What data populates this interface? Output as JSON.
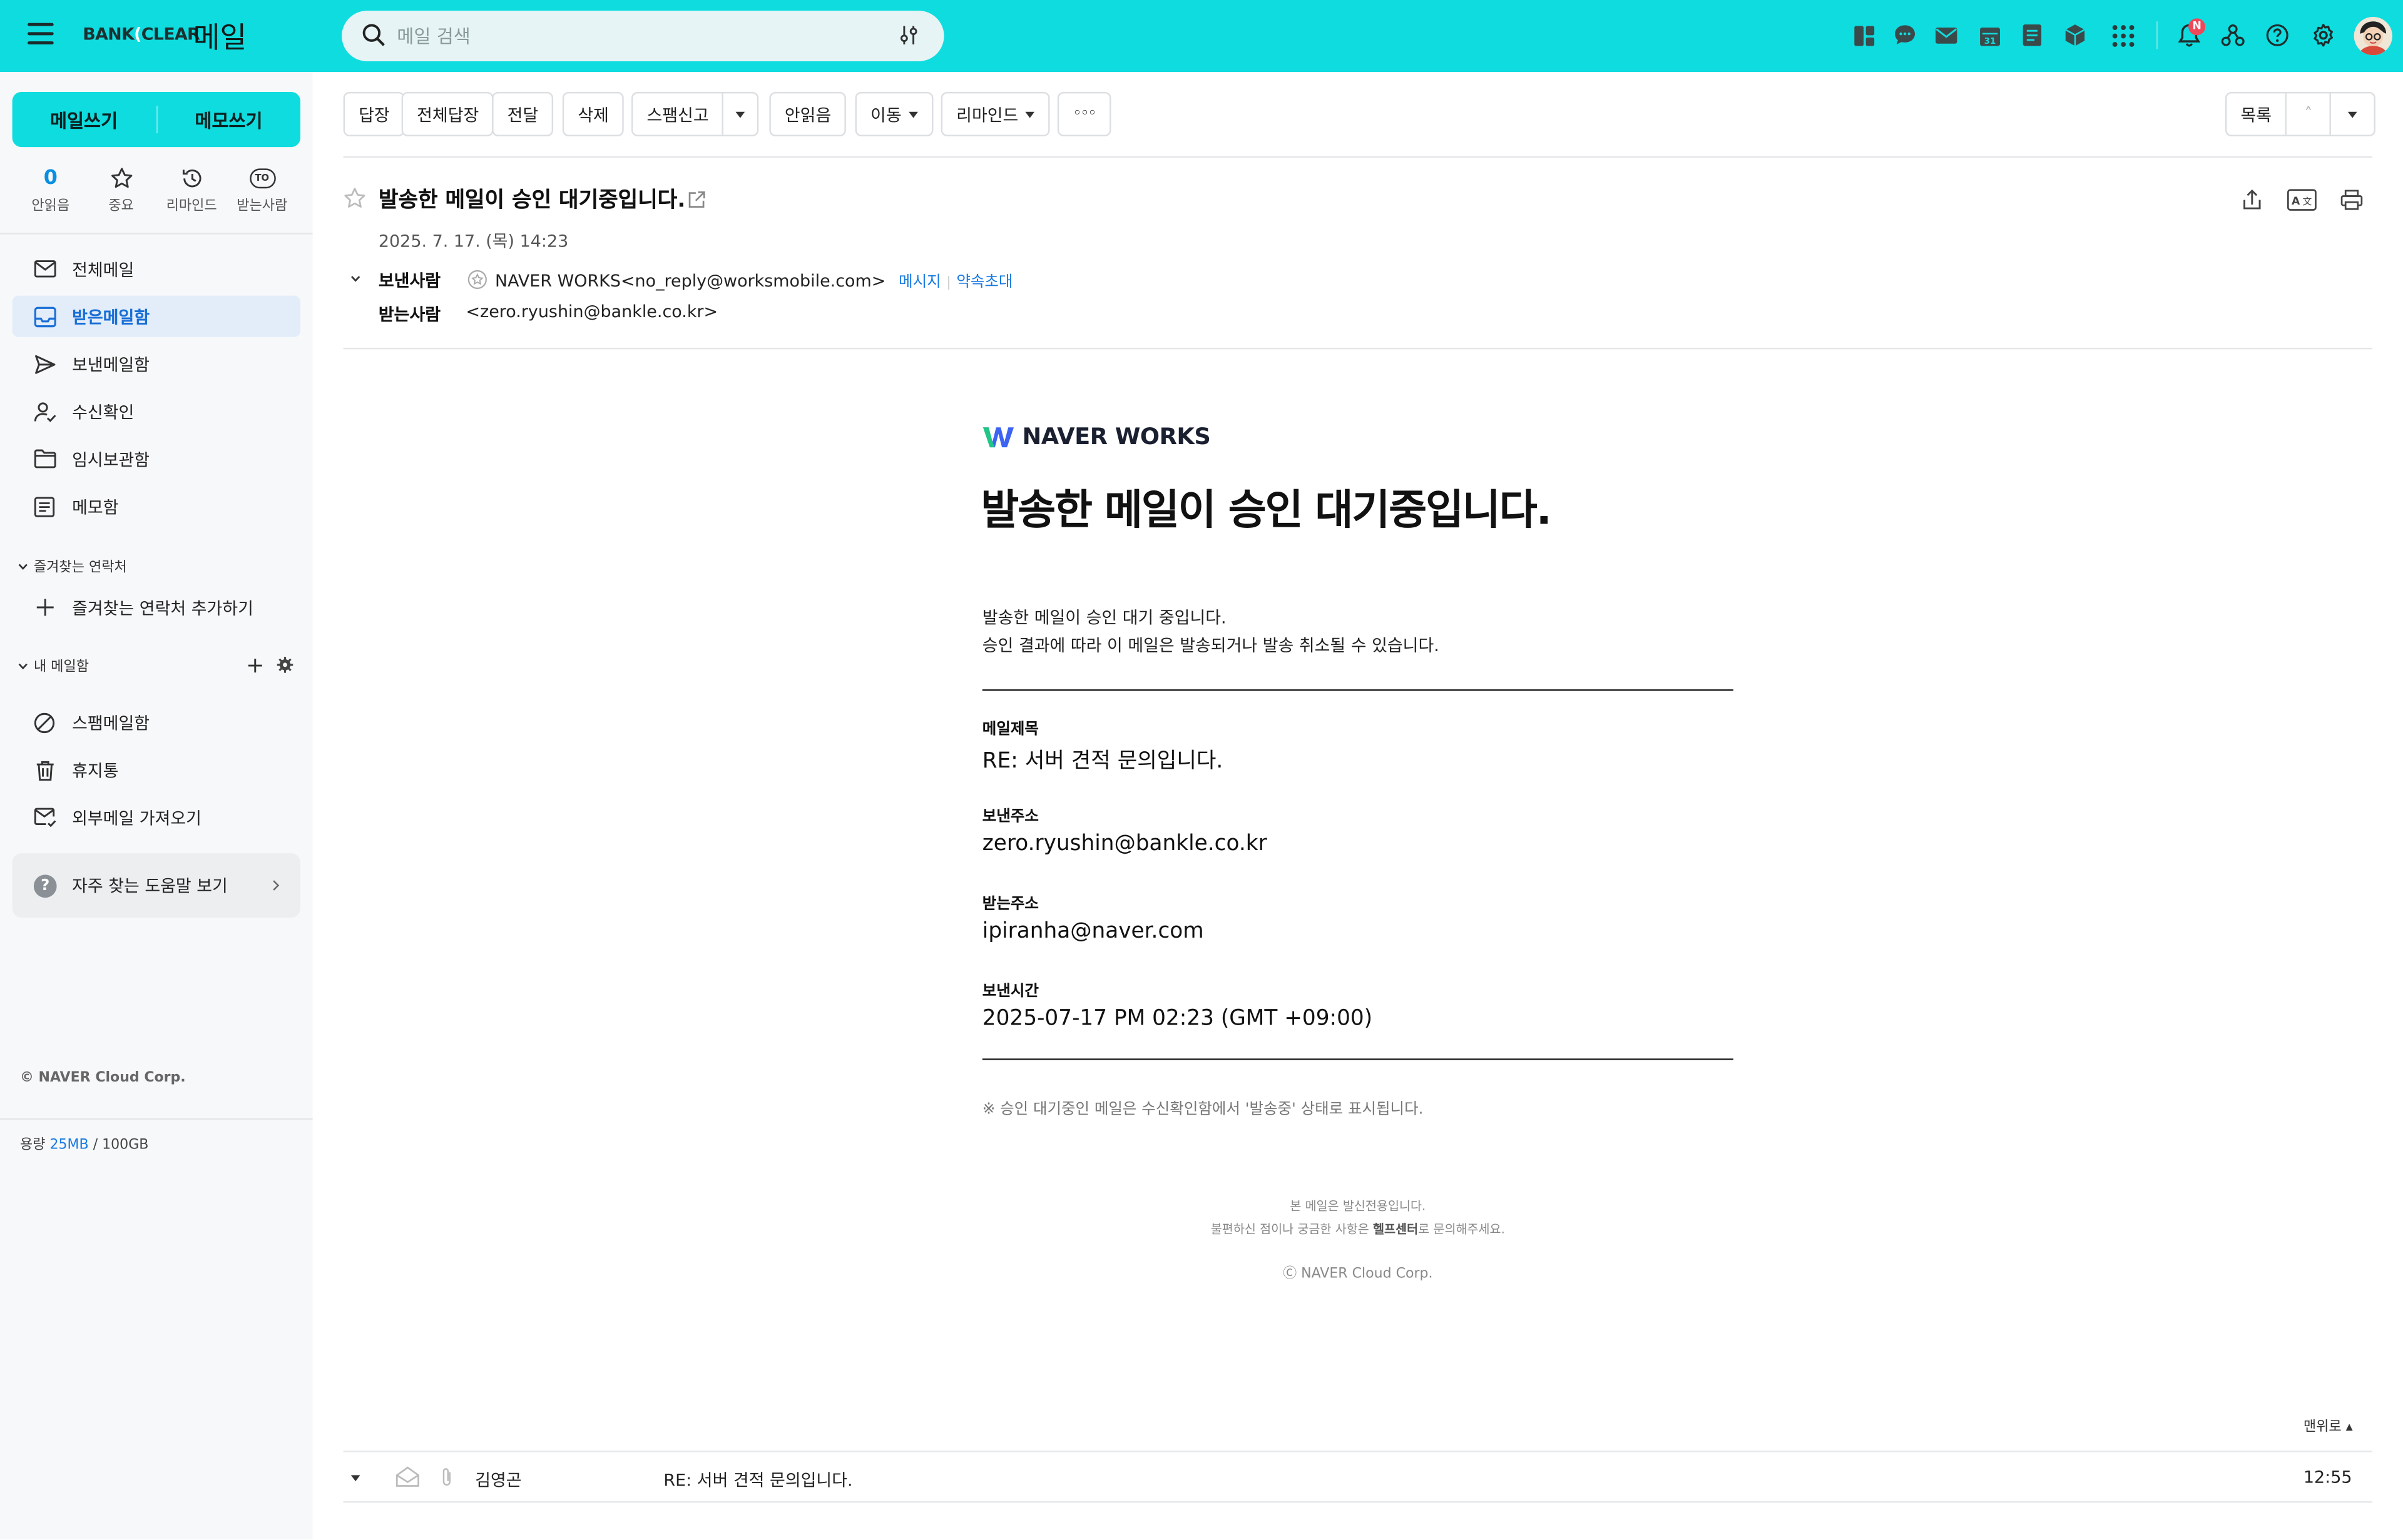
{
  "header": {
    "logo": {
      "pre": "BANK",
      "mid": "(",
      "post": "CLEAR"
    },
    "app_title": "메일",
    "search_placeholder": "메일 검색",
    "notification_badge": "N"
  },
  "sidebar": {
    "compose_mail": "메일쓰기",
    "compose_memo": "메모쓰기",
    "quick": [
      {
        "value": "0",
        "label": "안읽음"
      },
      {
        "label": "중요"
      },
      {
        "label": "리마인드"
      },
      {
        "label": "받는사람",
        "icon_text": "TO"
      }
    ],
    "folders": [
      {
        "label": "전체메일",
        "icon": "mail-icon"
      },
      {
        "label": "받은메일함",
        "icon": "inbox-icon"
      },
      {
        "label": "보낸메일함",
        "icon": "send-icon"
      },
      {
        "label": "수신확인",
        "icon": "read-receipt-icon"
      },
      {
        "label": "임시보관함",
        "icon": "folder-icon"
      },
      {
        "label": "메모함",
        "icon": "memo-icon"
      }
    ],
    "favorites_header": "즐겨찾는 연락처",
    "add_favorite": "즐겨찾는 연락처 추가하기",
    "my_mailbox_header": "내 메일함",
    "other_folders": [
      {
        "label": "스팸메일함",
        "icon": "spam-icon"
      },
      {
        "label": "휴지통",
        "icon": "trash-icon"
      },
      {
        "label": "외부메일 가져오기",
        "icon": "external-mail-icon"
      }
    ],
    "help": "자주 찾는 도움말 보기",
    "copyright": "© NAVER Cloud Corp.",
    "storage_label": "용량",
    "storage_used": "25MB",
    "storage_total": "/ 100GB"
  },
  "toolbar": {
    "reply": "답장",
    "reply_all": "전체답장",
    "forward": "전달",
    "delete": "삭제",
    "spam": "스팸신고",
    "unread": "안읽음",
    "move": "이동",
    "remind": "리마인드",
    "more": "◦◦◦",
    "list": "목록",
    "prev": "˄"
  },
  "mail": {
    "subject": "발송한 메일이 승인 대기중입니다.",
    "date": "2025. 7. 17. (목) 14:23",
    "from_label": "보낸사람",
    "from_value": "NAVER WORKS<no_reply@worksmobile.com>",
    "from_link_message": "메시지",
    "from_link_invite": "약속초대",
    "to_label": "받는사람",
    "to_value": "<zero.ryushin@bankle.co.kr>"
  },
  "body": {
    "brand": "NAVER WORKS",
    "title": "발송한 메일이 승인 대기중입니다.",
    "line1": "발송한 메일이 승인 대기 중입니다.",
    "line2": "승인 결과에 따라 이 메일은 발송되거나 발송 취소될 수 있습니다.",
    "fields": [
      {
        "label": "메일제목",
        "value": "RE: 서버 견적 문의입니다."
      },
      {
        "label": "보낸주소",
        "value": "zero.ryushin@bankle.co.kr"
      },
      {
        "label": "받는주소",
        "value": "ipiranha@naver.com"
      },
      {
        "label": "보낸시간",
        "value": "2025-07-17 PM 02:23 (GMT +09:00)"
      }
    ],
    "note": "※ 승인 대기중인 메일은 수신확인함에서 '발송중' 상태로 표시됩니다.",
    "footer1": "본 메일은 발신전용입니다.",
    "footer2_pre": "불편하신 점이나 궁금한 사항은 ",
    "footer2_link": "헬프센터",
    "footer2_post": "로 문의해주세요.",
    "footer3": "Ⓒ NAVER Cloud Corp."
  },
  "bottom": {
    "to_top": "맨위로 ▴",
    "sender": "김영곤",
    "subject": "RE: 서버 견적 문의입니다.",
    "time": "12:55"
  },
  "colors": {
    "accent": "#0fdcdf",
    "link": "#1a7ae0",
    "active_bg": "#e3edfa"
  }
}
